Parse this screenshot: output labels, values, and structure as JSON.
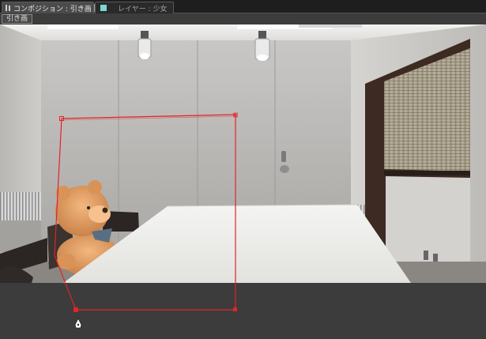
{
  "tabs": [
    {
      "label": "コンポジション : 引き画",
      "close": "×",
      "dropdown": "▾"
    },
    {
      "label": "レイヤー : 少女"
    }
  ],
  "breadcrumb": "引き画",
  "colors": {
    "panel_bg": "#3c3c3c",
    "tabbar_bg": "#1e1e1e",
    "mask_path": "#e0242a",
    "layer_swatch": "#7fd6d0"
  },
  "icons": {
    "viewer_lock": "lock-icon",
    "panel_menu": "panel-menu-icon",
    "layer_swatch": "layer-color-swatch",
    "cursor": "pen-cursor-icon"
  }
}
